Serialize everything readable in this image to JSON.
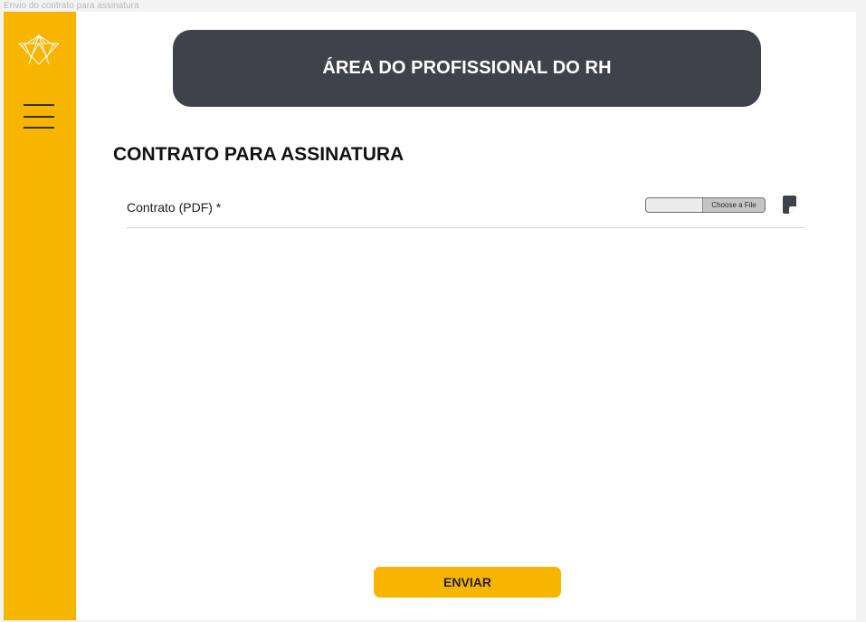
{
  "frame": {
    "label": "Envio do contrato para assinatura"
  },
  "header": {
    "title": "ÁREA DO PROFISSIONAL DO RH"
  },
  "section": {
    "title": "CONTRATO PARA ASSINATURA"
  },
  "form": {
    "contract_label": "Contrato (PDF) *",
    "file_value": "",
    "choose_label": "Choose a File"
  },
  "actions": {
    "submit_label": "ENVIAR"
  },
  "icons": {
    "logo": "triangular-crystal-logo",
    "menu": "hamburger-menu-icon",
    "note": "sticky-note-icon"
  },
  "colors": {
    "sidebar": "#f7b500",
    "header_bg": "#3e434b",
    "header_text": "#ffffff",
    "button": "#f7b500"
  }
}
